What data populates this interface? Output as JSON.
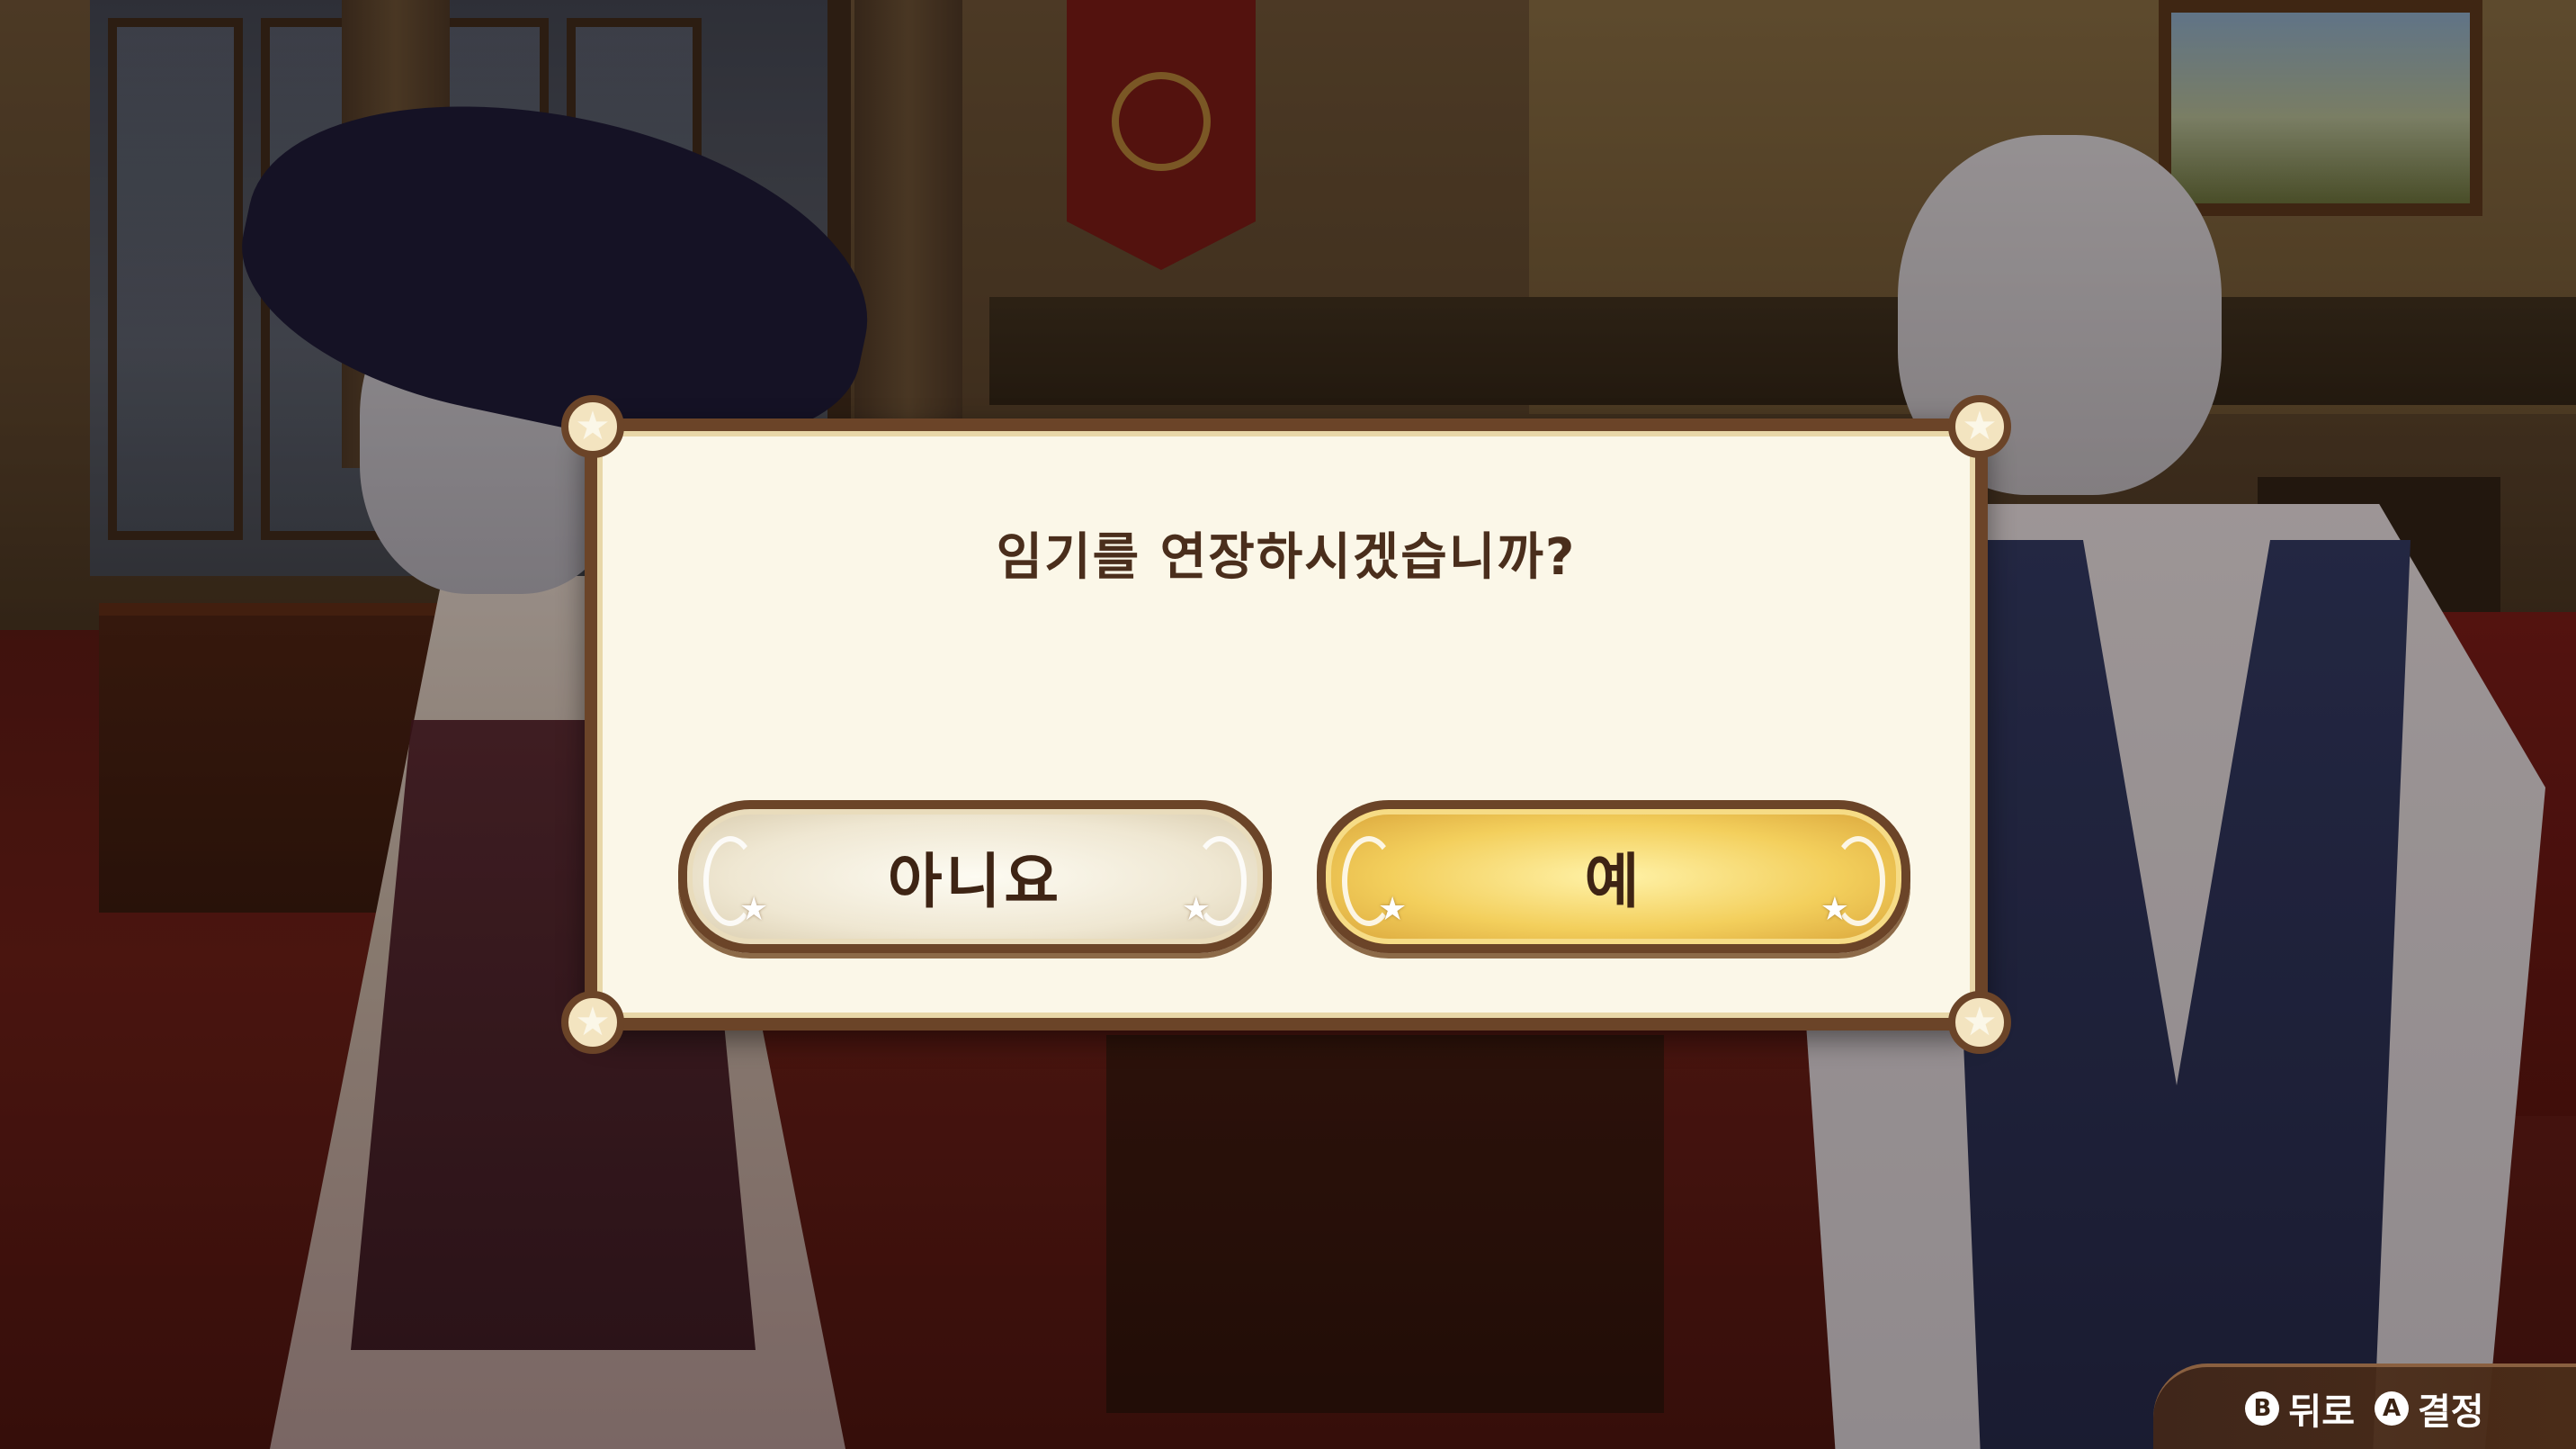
{
  "dialog": {
    "question": "임기를 연장하시겠습니까?",
    "no_label": "아니요",
    "yes_label": "예"
  },
  "controls": {
    "back": {
      "button": "B",
      "label": "뒤로"
    },
    "confirm": {
      "button": "A",
      "label": "결정"
    }
  },
  "colors": {
    "dialog_bg": "#fbf7e8",
    "dialog_border": "#6b4428",
    "text": "#4a2e1c",
    "yes_button": "#f3cf5c",
    "no_button": "#efe7d2"
  }
}
